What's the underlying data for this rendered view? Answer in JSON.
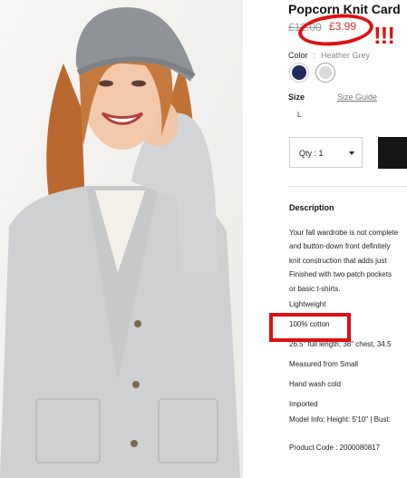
{
  "product": {
    "title": "Popcorn Knit Card",
    "old_price": "£12.00",
    "new_price": "£3.99",
    "color_label": "Color",
    "color_separator": ":",
    "color_value": "Heather Grey",
    "swatches": [
      {
        "name": "navy",
        "color": "#202a5a"
      },
      {
        "name": "heather-grey",
        "color": "#d7d9db",
        "selected": true
      }
    ],
    "size_label": "Size",
    "size_guide": "Size Guide",
    "size_value": "L",
    "qty_label": "Qty : 1"
  },
  "description": {
    "title": "Description",
    "lines": [
      "Your fall wardrobe is not complete",
      "and button-down front definitely",
      "knit construction that adds just",
      "Finished with two patch pockets",
      "or basic t-shirts."
    ],
    "features": [
      "Lightweight",
      "100% cotton",
      "26.5\" full length, 38\" chest, 34.5",
      "Measured from Small",
      "Hand wash cold",
      "Imported",
      "Model Info: Height: 5'10\" | Bust:",
      "Product Code : 2000080817"
    ]
  },
  "annotation": {
    "exclamation": "!!!",
    "color": "#e01010"
  }
}
